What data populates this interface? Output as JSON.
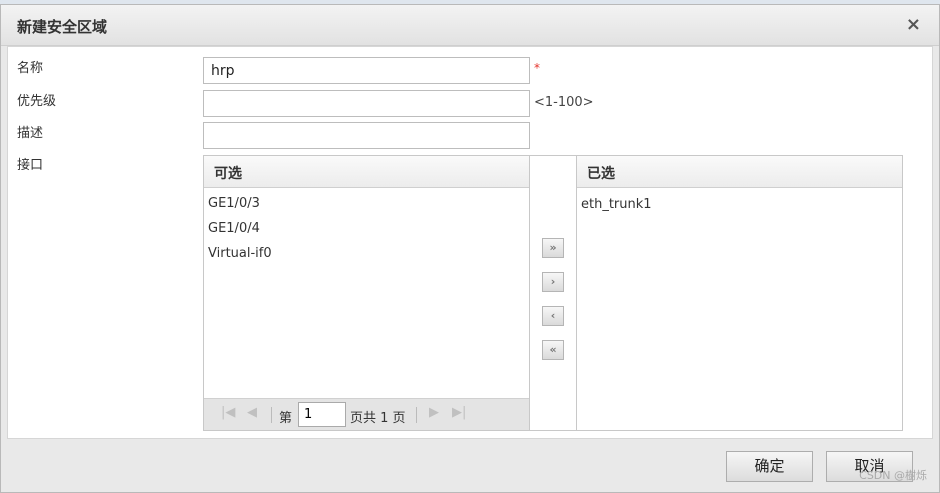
{
  "dialog": {
    "title": "新建安全区域",
    "close_symbol": "×"
  },
  "form": {
    "name_label": "名称",
    "name_value": "hrp",
    "required_mark": "*",
    "priority_label": "优先级",
    "priority_value": "",
    "priority_range": "<1-100>",
    "description_label": "描述",
    "description_value": "",
    "interface_label": "接口"
  },
  "available": {
    "header": "可选",
    "items": [
      "GE1/0/3",
      "GE1/0/4",
      "Virtual-if0"
    ]
  },
  "selected": {
    "header": "已选",
    "items": [
      "eth_trunk1"
    ]
  },
  "pager": {
    "page_prefix": "第",
    "page_value": "1",
    "page_suffix": "页共 1 页"
  },
  "transfer_buttons": {
    "add_all": "»",
    "add": "›",
    "remove": "‹",
    "remove_all": "«"
  },
  "footer": {
    "ok_label": "确定",
    "cancel_label": "取消"
  },
  "watermark": "CSDN @樹烁",
  "colors": {
    "required": "#e4322b",
    "header_bg": "#ececec",
    "pager_bg": "#e4e4e4"
  }
}
